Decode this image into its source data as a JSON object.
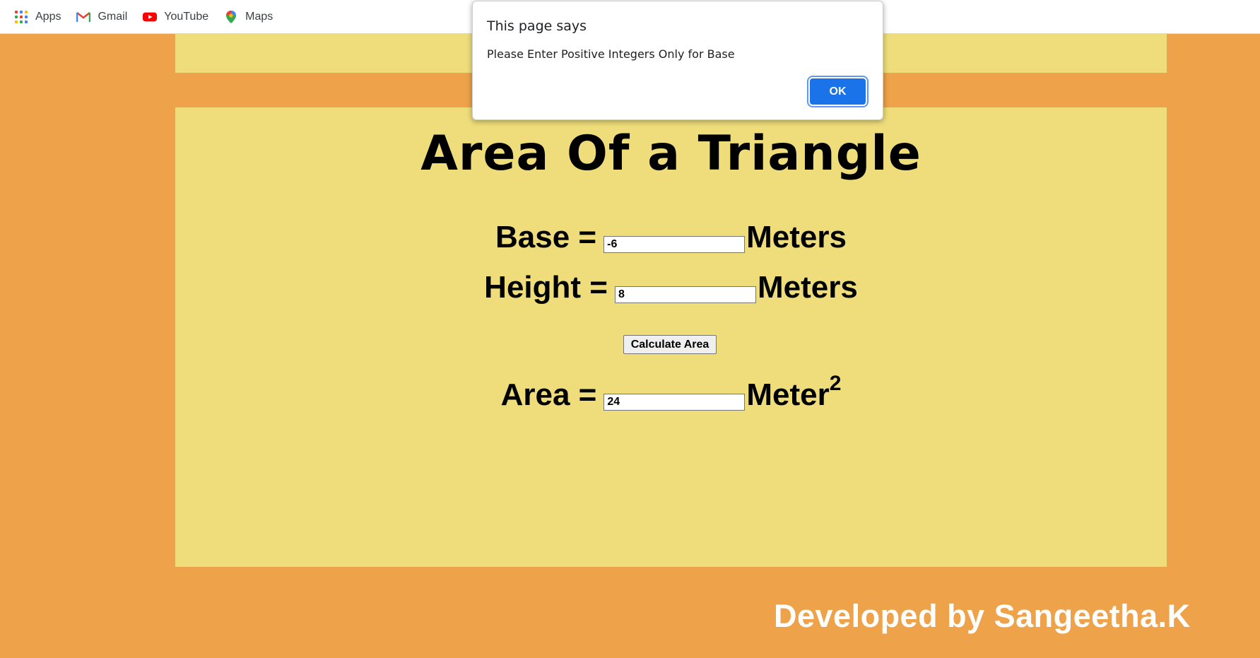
{
  "bookmarks": [
    {
      "label": "Apps",
      "icon": "apps-grid-icon"
    },
    {
      "label": "Gmail",
      "icon": "gmail-icon"
    },
    {
      "label": "YouTube",
      "icon": "youtube-icon"
    },
    {
      "label": "Maps",
      "icon": "maps-pin-icon"
    }
  ],
  "page": {
    "title": "Area Of a Triangle",
    "base": {
      "label": "Base =",
      "value": "-6",
      "unit": "Meters"
    },
    "height": {
      "label": "Height =",
      "value": "8",
      "unit": "Meters"
    },
    "calculate_label": "Calculate Area",
    "area": {
      "label": "Area =",
      "value": "24",
      "unit": "Meter",
      "exponent": "2"
    },
    "footer": "Developed by Sangeetha.K"
  },
  "dialog": {
    "title": "This page says",
    "message": "Please Enter Positive Integers Only for Base",
    "ok_label": "OK"
  },
  "colors": {
    "background": "#eea24a",
    "panel": "#eedd7a",
    "dialog_button": "#1a73e8"
  }
}
